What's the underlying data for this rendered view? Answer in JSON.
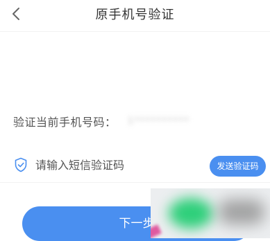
{
  "nav": {
    "title": "原手机号验证",
    "back_icon": "chevron-left-icon"
  },
  "phone": {
    "label": "验证当前手机号码：",
    "value": "1**********"
  },
  "code": {
    "icon": "shield-check-icon",
    "placeholder": "请输入短信验证码",
    "value": "",
    "send_label": "发送验证码"
  },
  "next_label": "下一步",
  "colors": {
    "accent": "#4a8ff0",
    "text": "#333333",
    "divider": "#f2f2f2"
  }
}
